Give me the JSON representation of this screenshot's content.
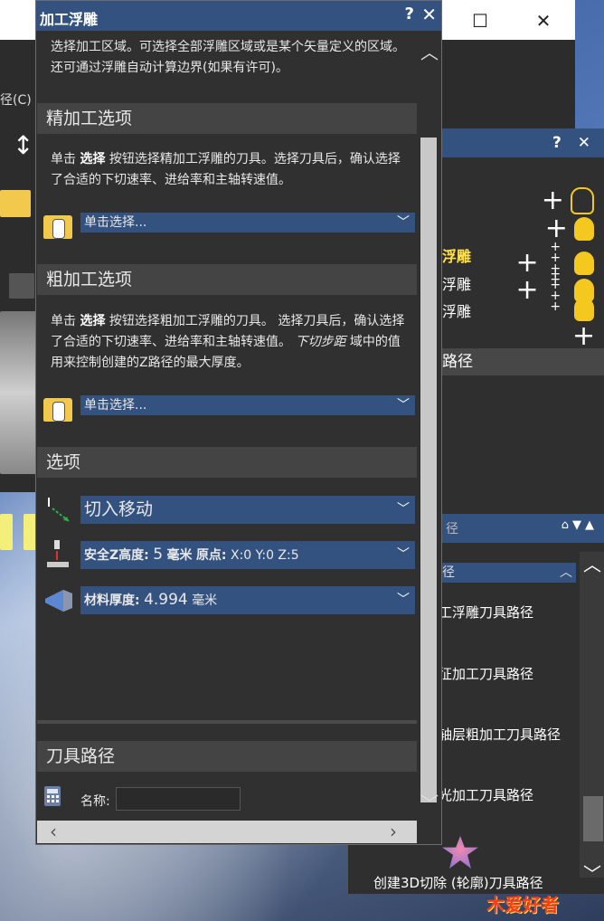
{
  "background_window": {
    "menu_fragment": "径(C)",
    "controls": {
      "maximize": "☐",
      "close": "✕"
    }
  },
  "right_panel": {
    "controls": {
      "help": "?",
      "close": "✕"
    },
    "layers": [
      {
        "label": "",
        "highlight": false
      },
      {
        "label": "",
        "highlight": false
      },
      {
        "label": "浮雕",
        "highlight": true
      },
      {
        "label": "浮雕",
        "highlight": false
      },
      {
        "label": "浮雕",
        "highlight": false
      }
    ],
    "section_title": "路径",
    "toolpath_dropdown": "径",
    "toolpath_fragment": "径",
    "items": [
      "工浮雕刀具路径",
      "征加工刀具路径",
      "轴层粗加工刀具路径",
      "光加工刀具路径"
    ],
    "bottom_item": "创建3D切除 (轮廓)刀具路径",
    "logo_text": "爱好者"
  },
  "dialog": {
    "title": "加工浮雕",
    "help": "?",
    "close": "✕",
    "intro": "选择加工区域。可选择全部浮雕区域或是某个矢量定义的区域。还可通过浮雕自动计算边界(如果有许可)。",
    "finish": {
      "heading": "精加工选项",
      "text_prefix": "单击",
      "text_bold": "选择",
      "text_suffix": "按钮选择精加工浮雕的刀具。选择刀具后，确认选择了合适的下切速率、进给率和主轴转速值。",
      "tool_value": "单击选择..."
    },
    "rough": {
      "heading": "粗加工选项",
      "text_prefix": "单击",
      "text_bold": "选择",
      "text_mid": "按钮选择粗加工浮雕的刀具。 选择刀具后，确认选择了合适的下切速率、进给率和主轴转速值。",
      "text_italic": "下切步距",
      "text_suffix": "域中的值用来控制创建的Z路径的最大厚度。",
      "tool_value": "单击选择..."
    },
    "options": {
      "heading": "选项",
      "lead_in": "切入移动",
      "safe_z_label": "安全Z高度:",
      "safe_z_value": "5",
      "safe_z_unit": "毫米",
      "origin_label": "原点:",
      "origin_value": "X:0 Y:0 Z:5",
      "material_label": "材料厚度:",
      "material_value": "4.994",
      "material_unit": "毫米"
    },
    "toolpath": {
      "heading": "刀具路径",
      "name_label": "名称:",
      "name_value": ""
    }
  },
  "colors": {
    "titlebar_blue": "#34527f",
    "panel_dark": "#303030",
    "section_gray": "#444444",
    "highlight_yellow": "#ffe24a",
    "folder_yellow": "#f2c94c"
  }
}
